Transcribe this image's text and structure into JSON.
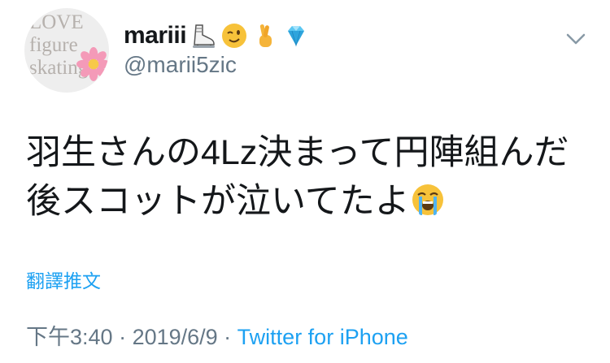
{
  "avatar": {
    "text_lines": [
      "LOVE",
      "figure",
      "skating"
    ]
  },
  "user": {
    "display_name": "mariii",
    "handle": "@marii5zic",
    "name_emojis": [
      "ice-skate-icon",
      "winking-face-icon",
      "crossed-fingers-icon",
      "gem-icon"
    ]
  },
  "tweet": {
    "line1": "羽生さんの4Lz決まって円陣組んだ",
    "line2": "後スコットが泣いてたよ",
    "trailing_emoji": "loudly-crying-face-icon"
  },
  "translate_label": "翻譯推文",
  "meta": {
    "time": "下午3:40",
    "separator": " · ",
    "date": "2019/6/9",
    "source": "Twitter for iPhone"
  },
  "colors": {
    "link": "#1da1f2",
    "secondary": "#657786",
    "text": "#14171a"
  }
}
